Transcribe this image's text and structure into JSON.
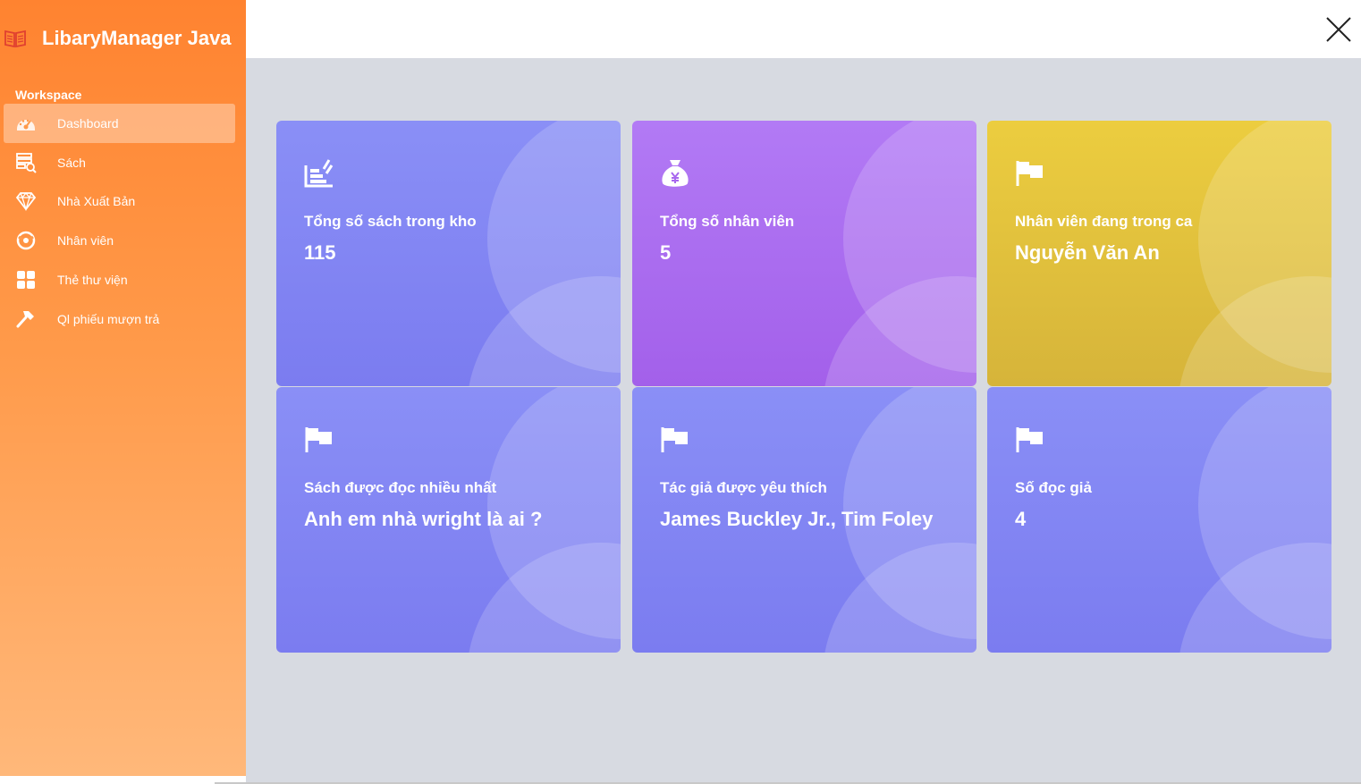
{
  "app": {
    "title": "LibaryManager Java"
  },
  "sidebar": {
    "section_label": "Workspace",
    "items": [
      {
        "label": "Dashboard",
        "icon": "dashboard-gauge-icon",
        "active": true
      },
      {
        "label": "Sách",
        "icon": "book-search-icon",
        "active": false
      },
      {
        "label": "Nhà Xuất Bản",
        "icon": "diamond-icon",
        "active": false
      },
      {
        "label": "Nhân viên",
        "icon": "users-icon",
        "active": false
      },
      {
        "label": "Thẻ thư viện",
        "icon": "grid-icon",
        "active": false
      },
      {
        "label": "Ql phiếu mượn trả",
        "icon": "hammer-icon",
        "active": false
      }
    ]
  },
  "header": {
    "close_icon": "close-icon"
  },
  "cards": [
    {
      "label": "Tổng số sách trong kho",
      "value": "115",
      "icon": "books-stack-icon",
      "color": "#8a8ff6"
    },
    {
      "label": "Tổng số nhân viên",
      "value": "5",
      "icon": "money-bag-icon",
      "color": "#b27af5"
    },
    {
      "label": "Nhân viên đang trong ca",
      "value": "Nguyễn Văn An",
      "icon": "flag-icon",
      "color": "#eccd3f"
    },
    {
      "label": "Sách được đọc nhiều nhất",
      "value": "Anh em nhà wright là ai ?",
      "icon": "flag-icon",
      "color": "#8a8ff6"
    },
    {
      "label": "Tác giả được yêu thích",
      "value": "James Buckley Jr., Tim Foley",
      "icon": "flag-icon",
      "color": "#8a8ff6"
    },
    {
      "label": "Số đọc giả",
      "value": "4",
      "icon": "flag-icon",
      "color": "#8a8ff6"
    }
  ]
}
